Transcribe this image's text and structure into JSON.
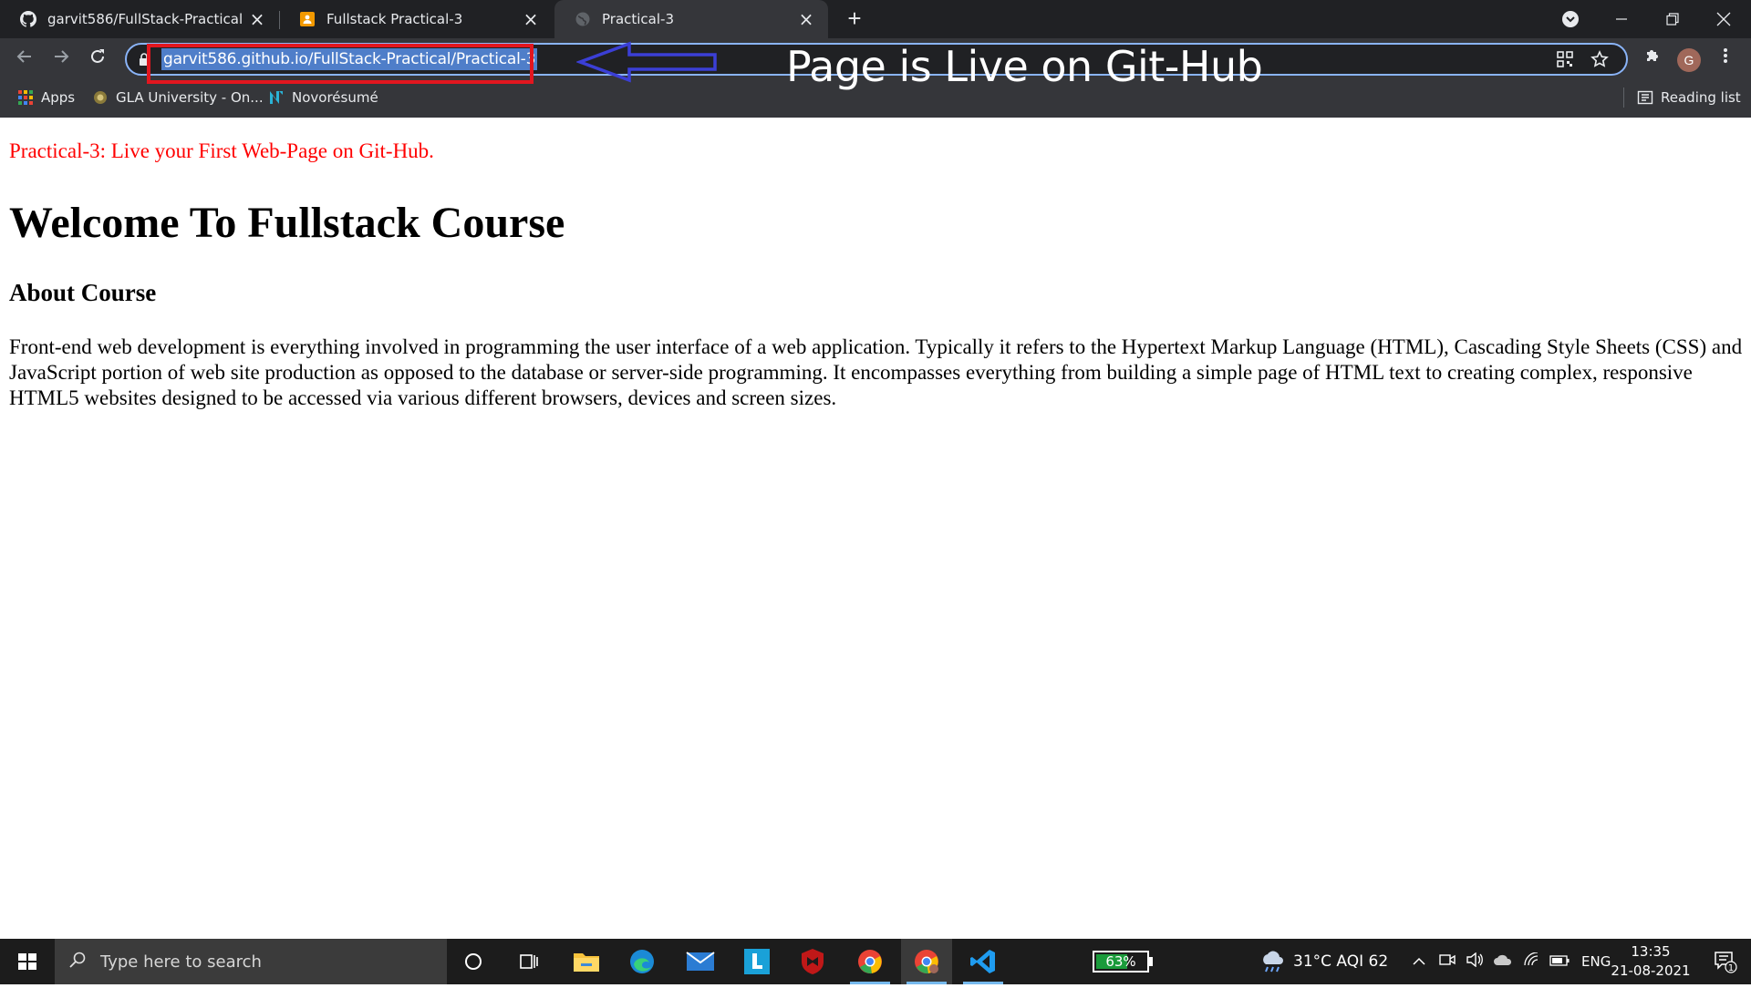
{
  "browser": {
    "tabs": [
      {
        "title": "garvit586/FullStack-Practical",
        "icon": "github-icon",
        "active": false
      },
      {
        "title": "Fullstack Practical-3",
        "icon": "slides-icon",
        "active": false
      },
      {
        "title": "Practical-3",
        "icon": "globe-icon",
        "active": true
      }
    ],
    "url": "garvit586.github.io/FullStack-Practical/Practical-3",
    "annotation_text": "Page is Live on Git-Hub",
    "avatar_letter": "G",
    "bookmarks": [
      {
        "label": "Apps",
        "icon": "apps-grid-icon"
      },
      {
        "label": "GLA University - On...",
        "icon": "gla-logo-icon"
      },
      {
        "label": "Novorésumé",
        "icon": "novoresume-icon"
      }
    ],
    "reading_list": "Reading list",
    "colors": {
      "frame": "#202124",
      "toolbar": "#35363a",
      "annotation_box": "#e2161f",
      "annotation_arrow": "#3b3fd6",
      "url_selection": "#4f7ec9"
    }
  },
  "page": {
    "subtitle": "Practical-3: Live your First Web-Page on Git-Hub.",
    "heading": "Welcome To Fullstack Course",
    "subheading": "About Course",
    "paragraph": "Front-end web development is everything involved in programming the user interface of a web application. Typically it refers to the Hypertext Markup Language (HTML), Cascading Style Sheets (CSS) and JavaScript portion of web site production as opposed to the database or server-side programming. It encompasses everything from building a simple page of HTML text to creating complex, responsive HTML5 websites designed to be accessed via various different browsers, devices and screen sizes.",
    "colors": {
      "subtitle": "#ff0000"
    }
  },
  "taskbar": {
    "search_placeholder": "Type here to search",
    "battery_widget_text": "63%",
    "battery_level": 0.63,
    "weather": "31°C  AQI 62",
    "language": "ENG",
    "time": "13:35",
    "date": "21-08-2021",
    "notification_count": "1"
  }
}
